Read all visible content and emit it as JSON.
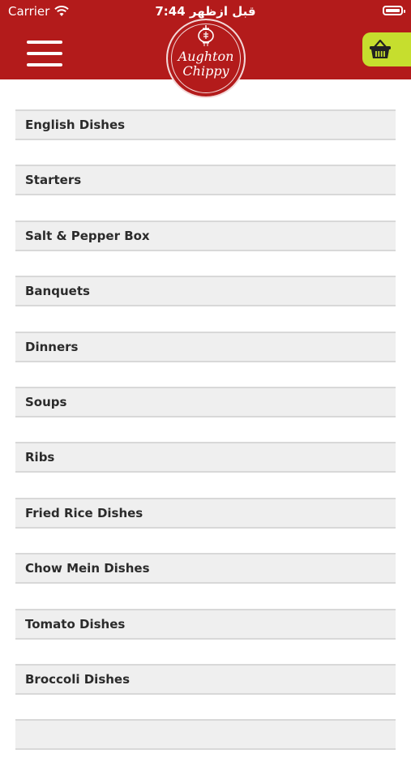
{
  "status_bar": {
    "carrier": "Carrier",
    "time": "7:44 قبل ازظهر"
  },
  "header": {
    "logo_line1": "Aughton",
    "logo_line2": "Chippy",
    "accent_color": "#b31b1b",
    "cart_color": "#c6de2e",
    "menu_icon": "hamburger-icon",
    "cart_icon": "basket-icon"
  },
  "categories": [
    {
      "label": "English Dishes"
    },
    {
      "label": "Starters"
    },
    {
      "label": "Salt & Pepper Box"
    },
    {
      "label": "Banquets"
    },
    {
      "label": "Dinners"
    },
    {
      "label": "Soups"
    },
    {
      "label": "Ribs"
    },
    {
      "label": "Fried Rice Dishes"
    },
    {
      "label": "Chow Mein Dishes"
    },
    {
      "label": "Tomato Dishes"
    },
    {
      "label": "Broccoli Dishes"
    },
    {
      "label": ""
    }
  ]
}
